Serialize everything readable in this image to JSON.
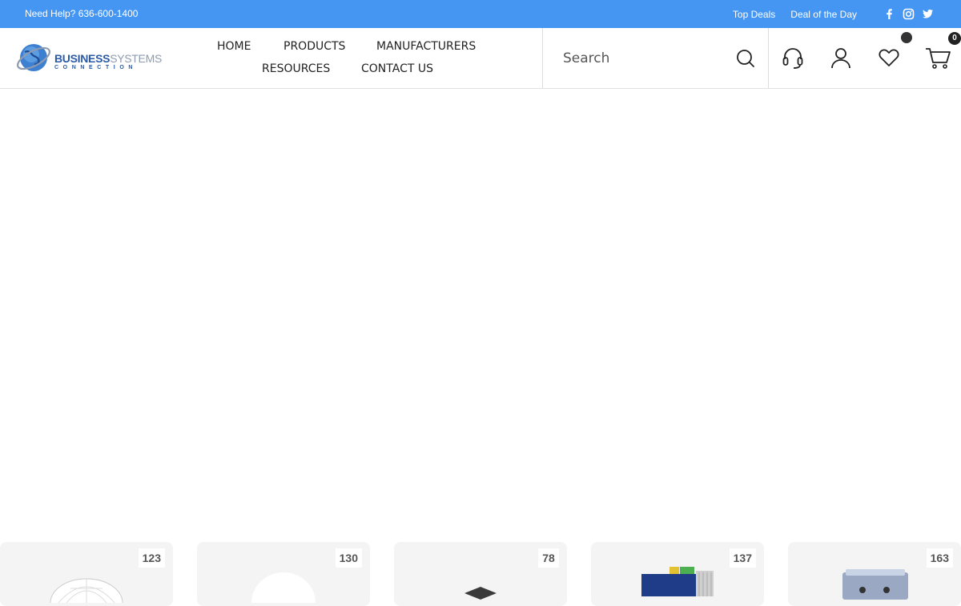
{
  "topbar": {
    "help_text": "Need Help? 636-600-1400",
    "links": [
      "Top Deals",
      "Deal of the Day"
    ],
    "social_icons": [
      "facebook-icon",
      "instagram-icon",
      "twitter-icon"
    ]
  },
  "header": {
    "logo": {
      "line1_a": "BUSINESS",
      "line1_b": "SYSTEMS",
      "line2": "CONNECTION"
    },
    "nav": [
      "HOME",
      "PRODUCTS",
      "MANUFACTURERS",
      "RESOURCES",
      "CONTACT US"
    ],
    "search": {
      "placeholder": "Search",
      "value": ""
    },
    "icons": [
      "headset-icon",
      "user-icon",
      "heart-icon",
      "cart-icon"
    ],
    "cart_count": "0"
  },
  "categories": [
    {
      "count": "123",
      "thumb": "dish-antenna"
    },
    {
      "count": "130",
      "thumb": "dome-radome"
    },
    {
      "count": "78",
      "thumb": "black-device"
    },
    {
      "count": "137",
      "thumb": "industrial-switch"
    },
    {
      "count": "163",
      "thumb": "enclosure-box"
    }
  ],
  "colors": {
    "topbar": "#4596f3",
    "brand": "#2b5aa6",
    "card_bg": "#f4f4f4"
  }
}
